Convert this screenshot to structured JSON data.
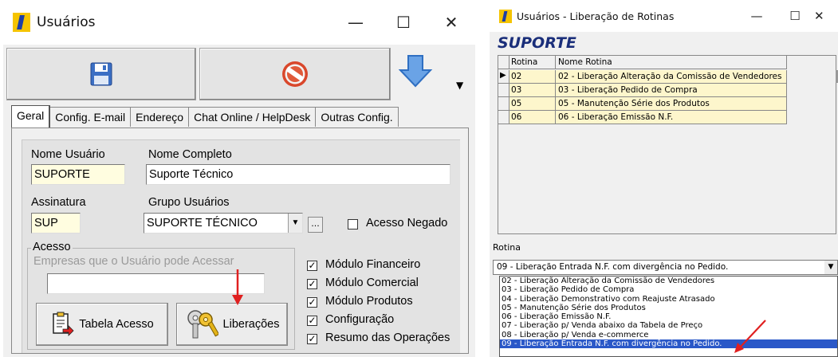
{
  "accent_red": "#e02020",
  "win1": {
    "title": "Usuários",
    "controls": {
      "minimize": "—",
      "maximize": "☐",
      "close": "✕"
    },
    "tabs": [
      "Geral",
      "Config. E-mail",
      "Endereço",
      "Chat Online / HelpDesk",
      "Outras Config."
    ],
    "active_tab": "Geral",
    "fields": {
      "nome_usuario_label": "Nome Usuário",
      "nome_usuario": "SUPORTE",
      "nome_completo_label": "Nome Completo",
      "nome_completo": "Suporte Técnico",
      "assinatura_label": "Assinatura",
      "assinatura": "SUP",
      "grupo_label": "Grupo Usuários",
      "grupo": "SUPORTE TÉCNICO",
      "ellipsis": "...",
      "acesso_negado_label": "Acesso Negado"
    },
    "acesso": {
      "legend": "Acesso",
      "empresas_label": "Empresas que o Usuário pode Acessar",
      "empresas_value": ""
    },
    "modules": [
      {
        "label": "Módulo Financeiro",
        "checked": true
      },
      {
        "label": "Módulo Comercial",
        "checked": true
      },
      {
        "label": "Módulo Produtos",
        "checked": true
      },
      {
        "label": "Configuração",
        "checked": true
      },
      {
        "label": "Resumo das Operações",
        "checked": true
      }
    ],
    "buttons": {
      "tabela_acesso": "Tabela Acesso",
      "liberacoes": "Liberações"
    },
    "icons": [
      "save-icon",
      "cancel-icon",
      "down-arrow-icon",
      "dropdown-caret-icon",
      "table-access-icon",
      "keys-icon"
    ]
  },
  "win2": {
    "title": "Usuários - Liberação de Rotinas",
    "controls": {
      "minimize": "—",
      "maximize": "☐",
      "close": "✕"
    },
    "user": "SUPORTE",
    "grid": {
      "headers": [
        "Rotina",
        "Nome Rotina"
      ],
      "rows": [
        {
          "rotina": "02",
          "nome": "02 - Liberação Alteração da Comissão de Vendedores"
        },
        {
          "rotina": "03",
          "nome": "03 - Liberação Pedido de Compra"
        },
        {
          "rotina": "05",
          "nome": "05 - Manutenção Série dos Produtos"
        },
        {
          "rotina": "06",
          "nome": "06 - Liberação Emissão N.F."
        }
      ]
    },
    "rotina_label": "Rotina",
    "rotina_selected": "09 - Liberação Entrada N.F. com divergência no Pedido.",
    "dropdown_options": [
      "02 - Liberação Alteração da Comissão de Vendedores",
      "03 - Liberação Pedido de Compra",
      "04 - Liberação Demonstrativo com Reajuste Atrasado",
      "05 - Manutenção Série dos Produtos",
      "06 - Liberação Emissão N.F.",
      "07 - Liberação p/ Venda abaixo da Tabela de Preço",
      "08 - Liberação p/ Venda e-commerce",
      "09 - Liberação Entrada N.F. com divergência no Pedido."
    ],
    "selected_index": 7
  }
}
